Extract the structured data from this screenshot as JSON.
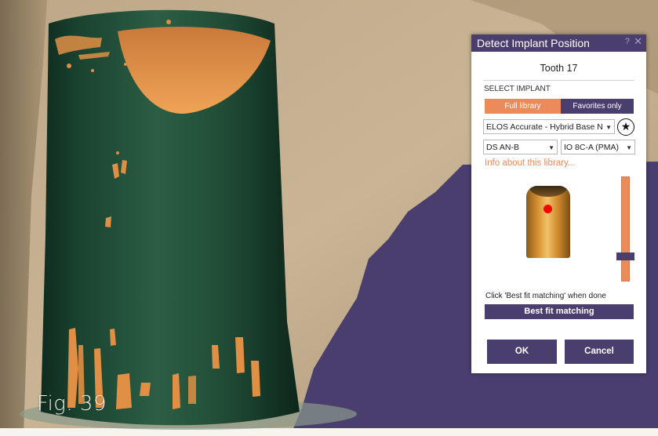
{
  "figure": {
    "label": "Fig. 39"
  },
  "dialog": {
    "title": "Detect Implant Position",
    "help_glyph": "?",
    "close_glyph": "✕",
    "tooth_label": "Tooth 17",
    "section_label": "SELECT IMPLANT",
    "library_toggle": {
      "full_label": "Full library",
      "favorites_label": "Favorites only",
      "active": "Full library"
    },
    "library_select": {
      "value": "ELOS Accurate - Hybrid Base N"
    },
    "favorite_icon": "star-icon",
    "variant_select_a": {
      "value": "DS AN-B"
    },
    "variant_select_b": {
      "value": "IO 8C-A (PMA)"
    },
    "info_link": "Info about this library...",
    "slider": {
      "level": 0.2
    },
    "hint": "Click 'Best fit matching' when done",
    "best_fit_label": "Best fit matching",
    "ok_label": "OK",
    "cancel_label": "Cancel"
  },
  "colors": {
    "accent": "#ec8b59",
    "primary": "#4a3e6e",
    "scan_green": "#1f4a35",
    "scan_orange": "#e08f45",
    "gum_beige": "#c2ad8c",
    "background_purple": "#4a3e6e"
  }
}
